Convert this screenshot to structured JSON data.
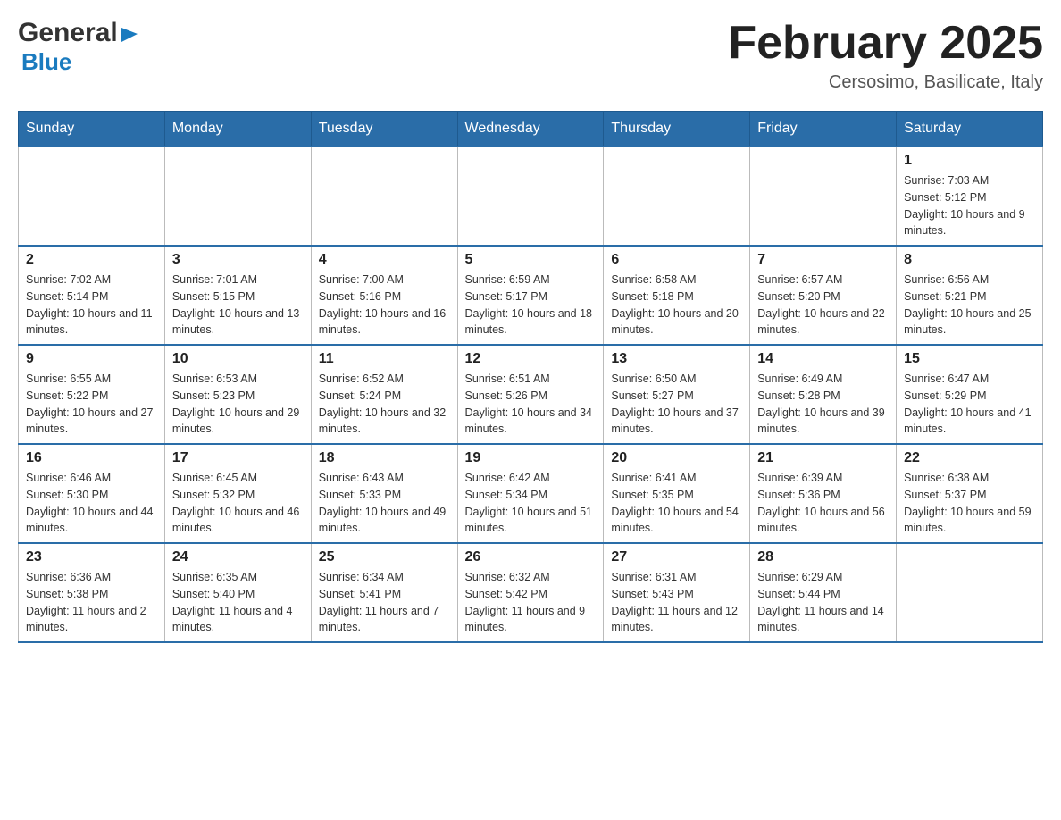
{
  "header": {
    "logo_general": "General",
    "logo_blue": "Blue",
    "month_title": "February 2025",
    "location": "Cersosimo, Basilicate, Italy"
  },
  "days_of_week": [
    "Sunday",
    "Monday",
    "Tuesday",
    "Wednesday",
    "Thursday",
    "Friday",
    "Saturday"
  ],
  "weeks": [
    [
      {
        "day": "",
        "info": ""
      },
      {
        "day": "",
        "info": ""
      },
      {
        "day": "",
        "info": ""
      },
      {
        "day": "",
        "info": ""
      },
      {
        "day": "",
        "info": ""
      },
      {
        "day": "",
        "info": ""
      },
      {
        "day": "1",
        "info": "Sunrise: 7:03 AM\nSunset: 5:12 PM\nDaylight: 10 hours and 9 minutes."
      }
    ],
    [
      {
        "day": "2",
        "info": "Sunrise: 7:02 AM\nSunset: 5:14 PM\nDaylight: 10 hours and 11 minutes."
      },
      {
        "day": "3",
        "info": "Sunrise: 7:01 AM\nSunset: 5:15 PM\nDaylight: 10 hours and 13 minutes."
      },
      {
        "day": "4",
        "info": "Sunrise: 7:00 AM\nSunset: 5:16 PM\nDaylight: 10 hours and 16 minutes."
      },
      {
        "day": "5",
        "info": "Sunrise: 6:59 AM\nSunset: 5:17 PM\nDaylight: 10 hours and 18 minutes."
      },
      {
        "day": "6",
        "info": "Sunrise: 6:58 AM\nSunset: 5:18 PM\nDaylight: 10 hours and 20 minutes."
      },
      {
        "day": "7",
        "info": "Sunrise: 6:57 AM\nSunset: 5:20 PM\nDaylight: 10 hours and 22 minutes."
      },
      {
        "day": "8",
        "info": "Sunrise: 6:56 AM\nSunset: 5:21 PM\nDaylight: 10 hours and 25 minutes."
      }
    ],
    [
      {
        "day": "9",
        "info": "Sunrise: 6:55 AM\nSunset: 5:22 PM\nDaylight: 10 hours and 27 minutes."
      },
      {
        "day": "10",
        "info": "Sunrise: 6:53 AM\nSunset: 5:23 PM\nDaylight: 10 hours and 29 minutes."
      },
      {
        "day": "11",
        "info": "Sunrise: 6:52 AM\nSunset: 5:24 PM\nDaylight: 10 hours and 32 minutes."
      },
      {
        "day": "12",
        "info": "Sunrise: 6:51 AM\nSunset: 5:26 PM\nDaylight: 10 hours and 34 minutes."
      },
      {
        "day": "13",
        "info": "Sunrise: 6:50 AM\nSunset: 5:27 PM\nDaylight: 10 hours and 37 minutes."
      },
      {
        "day": "14",
        "info": "Sunrise: 6:49 AM\nSunset: 5:28 PM\nDaylight: 10 hours and 39 minutes."
      },
      {
        "day": "15",
        "info": "Sunrise: 6:47 AM\nSunset: 5:29 PM\nDaylight: 10 hours and 41 minutes."
      }
    ],
    [
      {
        "day": "16",
        "info": "Sunrise: 6:46 AM\nSunset: 5:30 PM\nDaylight: 10 hours and 44 minutes."
      },
      {
        "day": "17",
        "info": "Sunrise: 6:45 AM\nSunset: 5:32 PM\nDaylight: 10 hours and 46 minutes."
      },
      {
        "day": "18",
        "info": "Sunrise: 6:43 AM\nSunset: 5:33 PM\nDaylight: 10 hours and 49 minutes."
      },
      {
        "day": "19",
        "info": "Sunrise: 6:42 AM\nSunset: 5:34 PM\nDaylight: 10 hours and 51 minutes."
      },
      {
        "day": "20",
        "info": "Sunrise: 6:41 AM\nSunset: 5:35 PM\nDaylight: 10 hours and 54 minutes."
      },
      {
        "day": "21",
        "info": "Sunrise: 6:39 AM\nSunset: 5:36 PM\nDaylight: 10 hours and 56 minutes."
      },
      {
        "day": "22",
        "info": "Sunrise: 6:38 AM\nSunset: 5:37 PM\nDaylight: 10 hours and 59 minutes."
      }
    ],
    [
      {
        "day": "23",
        "info": "Sunrise: 6:36 AM\nSunset: 5:38 PM\nDaylight: 11 hours and 2 minutes."
      },
      {
        "day": "24",
        "info": "Sunrise: 6:35 AM\nSunset: 5:40 PM\nDaylight: 11 hours and 4 minutes."
      },
      {
        "day": "25",
        "info": "Sunrise: 6:34 AM\nSunset: 5:41 PM\nDaylight: 11 hours and 7 minutes."
      },
      {
        "day": "26",
        "info": "Sunrise: 6:32 AM\nSunset: 5:42 PM\nDaylight: 11 hours and 9 minutes."
      },
      {
        "day": "27",
        "info": "Sunrise: 6:31 AM\nSunset: 5:43 PM\nDaylight: 11 hours and 12 minutes."
      },
      {
        "day": "28",
        "info": "Sunrise: 6:29 AM\nSunset: 5:44 PM\nDaylight: 11 hours and 14 minutes."
      },
      {
        "day": "",
        "info": ""
      }
    ]
  ]
}
